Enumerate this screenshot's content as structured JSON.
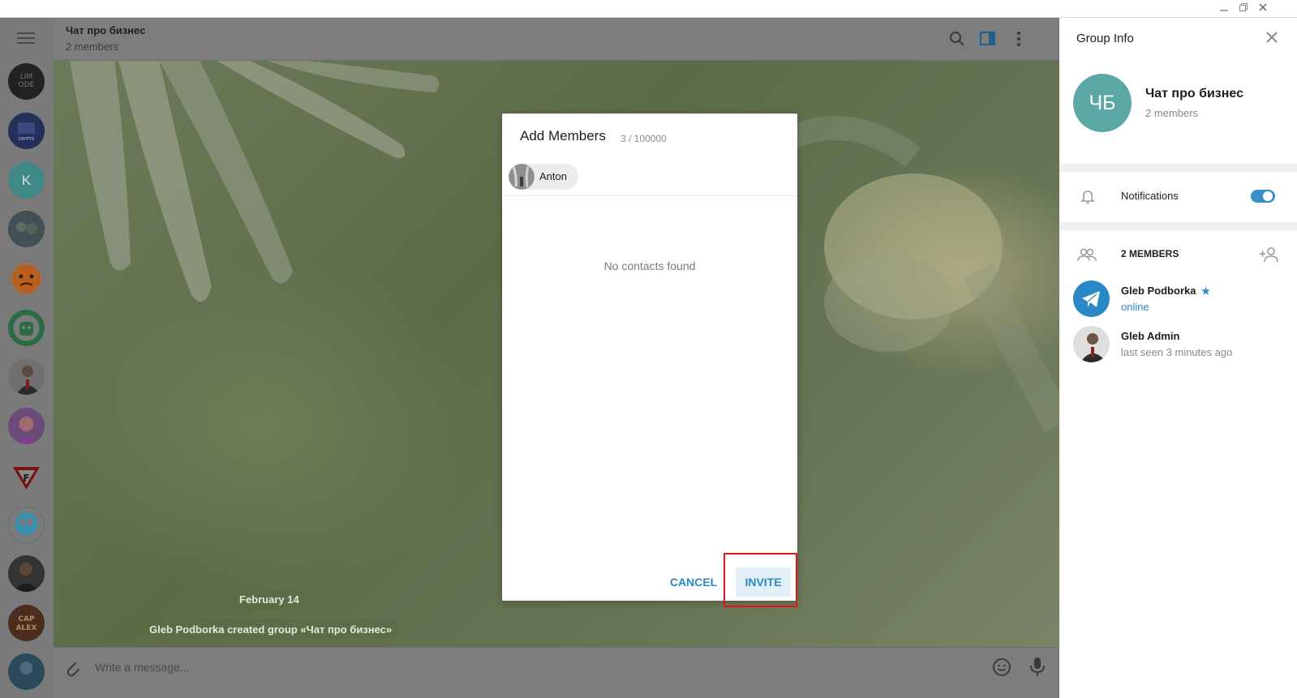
{
  "window": {
    "minimize_icon": "minimize-icon",
    "restore_icon": "restore-icon",
    "close_icon": "close-icon"
  },
  "sidebar": {
    "menu_icon": "hamburger-menu-icon",
    "chats": [
      {
        "name": "chat-avatar-1",
        "letter": ""
      },
      {
        "name": "chat-avatar-2",
        "letter": ""
      },
      {
        "name": "chat-avatar-k",
        "letter": "K"
      },
      {
        "name": "chat-avatar-4",
        "letter": ""
      },
      {
        "name": "chat-avatar-5",
        "letter": ""
      },
      {
        "name": "chat-avatar-6",
        "letter": ""
      },
      {
        "name": "chat-avatar-7",
        "letter": ""
      },
      {
        "name": "chat-avatar-8",
        "letter": ""
      },
      {
        "name": "chat-avatar-9",
        "letter": ""
      },
      {
        "name": "chat-avatar-10",
        "letter": ""
      },
      {
        "name": "chat-avatar-11",
        "letter": ""
      },
      {
        "name": "chat-avatar-12",
        "letter": ""
      },
      {
        "name": "chat-avatar-13",
        "letter": ""
      }
    ]
  },
  "chat": {
    "title": "Чат про бизнес",
    "subtitle": "2 members",
    "date_badge": "February 14",
    "service_message": "Gleb Podborka created group «Чат про бизнес»",
    "compose_placeholder": "Write a message..."
  },
  "group_info": {
    "title": "Group Info",
    "avatar_initials": "ЧБ",
    "name": "Чат про бизнес",
    "members_count": "2 members",
    "notifications_label": "Notifications",
    "notifications_on": true,
    "members_header": "2 MEMBERS",
    "members": [
      {
        "name": "Gleb Podborka",
        "status": "online",
        "star": "★"
      },
      {
        "name": "Gleb Admin",
        "status": "last seen 3 minutes ago"
      }
    ]
  },
  "dialog": {
    "title": "Add Members",
    "count": "3 / 100000",
    "chip_label": "Anton",
    "empty_text": "No contacts found",
    "cancel_label": "CANCEL",
    "invite_label": "INVITE"
  },
  "colors": {
    "accent": "#2a88c6",
    "highlight": "#e01717",
    "group_avatar": "#5ba7a5"
  }
}
